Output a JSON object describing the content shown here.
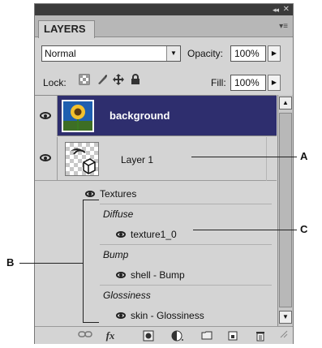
{
  "panel": {
    "collapse_glyph": "◂◂",
    "close_glyph": "✕",
    "tab_label": "LAYERS",
    "menu_glyph": "▾≡"
  },
  "controls": {
    "blend_mode": "Normal",
    "opacity_label": "Opacity:",
    "opacity_value": "100%",
    "lock_label": "Lock:",
    "fill_label": "Fill:",
    "fill_value": "100%",
    "dropdown_glyph": "▼",
    "stepper_glyph": "▶"
  },
  "layers": {
    "background": {
      "name": "background"
    },
    "layer1": {
      "name": "Layer 1"
    },
    "textures_label": "Textures",
    "groups": [
      {
        "label": "Diffuse",
        "item": "texture1_0"
      },
      {
        "label": "Bump",
        "item": "shell - Bump"
      },
      {
        "label": "Glossiness",
        "item": "skin - Glossiness"
      }
    ]
  },
  "footer_icons": [
    "link-layers",
    "fx",
    "add-mask",
    "adjustment",
    "new-group",
    "new-layer",
    "delete"
  ],
  "footer_glyphs": {
    "fx": "fx"
  },
  "callouts": {
    "a": "A",
    "b": "B",
    "c": "C"
  },
  "colors": {
    "selected_row": "#2e2e6e",
    "panel_bg": "#d4d4d4"
  }
}
